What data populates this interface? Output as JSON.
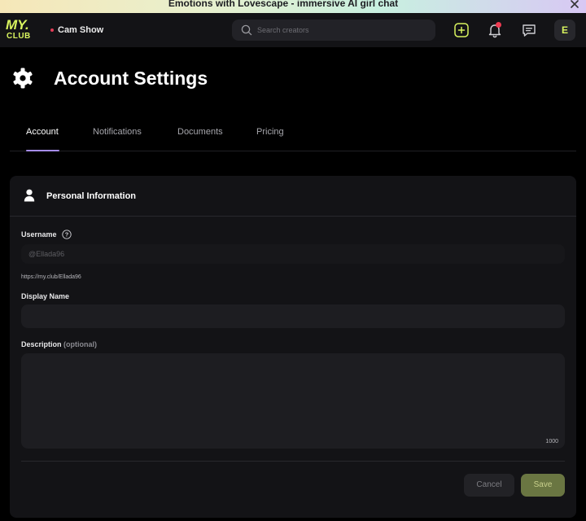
{
  "promo": {
    "text": "Emotions with Lovescape - immersive AI girl chat"
  },
  "topbar": {
    "logo_top": "MY.",
    "logo_bottom": "CLUB",
    "live_label": "Cam Show",
    "search": {
      "placeholder": "Search creators",
      "value": ""
    },
    "avatar_initial": "E",
    "accent": "#d9f45f",
    "notification_dot_color": "#ef3b52"
  },
  "page": {
    "title": "Account Settings",
    "icon": "gear-icon"
  },
  "tabs": [
    {
      "label": "Account",
      "active": true
    },
    {
      "label": "Notifications",
      "active": false
    },
    {
      "label": "Documents",
      "active": false
    },
    {
      "label": "Pricing",
      "active": false
    }
  ],
  "personal": {
    "title": "Personal Information",
    "username": {
      "label": "Username",
      "placeholder": "@Ellada96",
      "value": "",
      "url": "https://my.club/Ellada96"
    },
    "display_name": {
      "label": "Display Name",
      "value": ""
    },
    "description": {
      "label": "Description",
      "optional": "(optional)",
      "value": "",
      "char_count": "1000"
    },
    "cancel_label": "Cancel",
    "save_label": "Save"
  }
}
